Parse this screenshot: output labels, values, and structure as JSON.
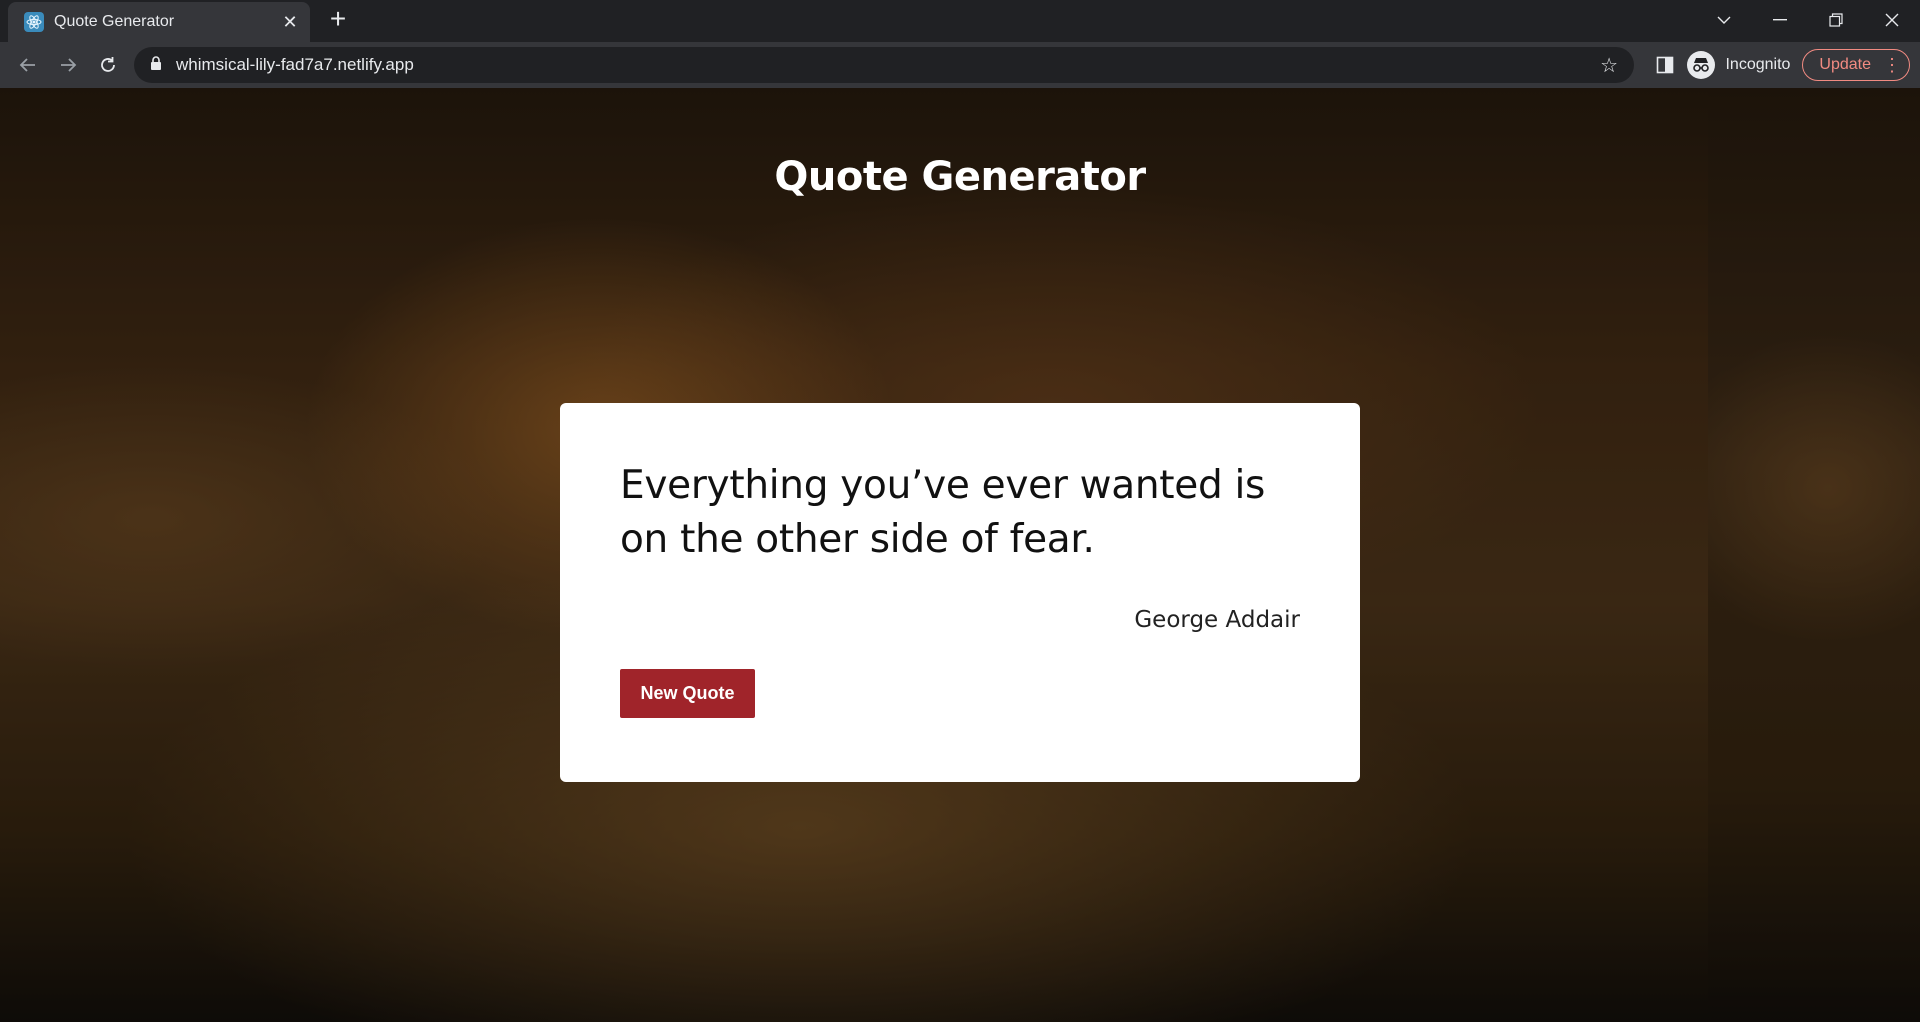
{
  "browser": {
    "tab_title": "Quote Generator",
    "url": "whimsical-lily-fad7a7.netlify.app",
    "incognito_label": "Incognito",
    "update_label": "Update"
  },
  "page": {
    "title": "Quote Generator",
    "quote_text": "Everything you’ve ever wanted is on the other side of fear.",
    "quote_author": "George Addair",
    "new_quote_label": "New Quote"
  },
  "colors": {
    "button": "#a0242a",
    "card": "#ffffff",
    "update_accent": "#f28b82"
  }
}
